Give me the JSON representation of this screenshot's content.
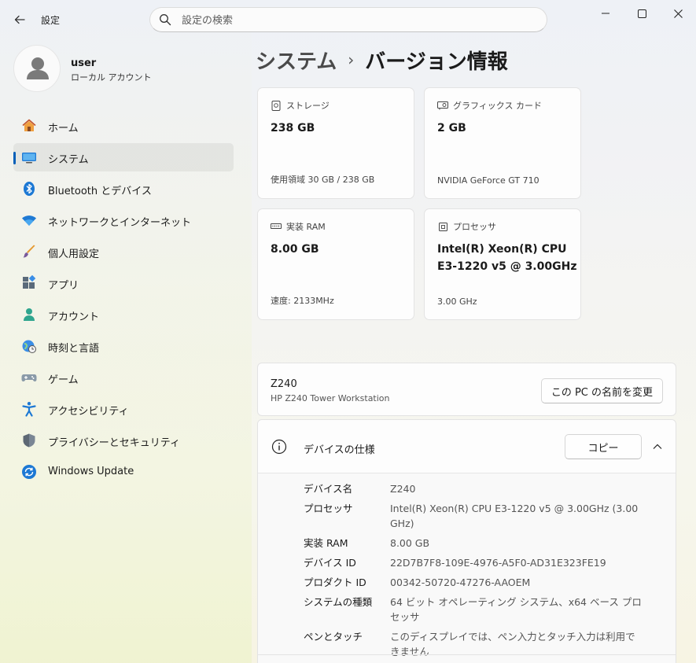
{
  "window": {
    "title": "設定"
  },
  "search": {
    "placeholder": "設定の検索"
  },
  "user": {
    "name": "user",
    "account_type": "ローカル アカウント"
  },
  "sidebar": {
    "items": [
      {
        "label": "ホーム",
        "icon": "home-icon"
      },
      {
        "label": "システム",
        "icon": "system-icon",
        "selected": true
      },
      {
        "label": "Bluetooth とデバイス",
        "icon": "bluetooth-icon"
      },
      {
        "label": "ネットワークとインターネット",
        "icon": "wifi-icon"
      },
      {
        "label": "個人用設定",
        "icon": "brush-icon"
      },
      {
        "label": "アプリ",
        "icon": "apps-icon"
      },
      {
        "label": "アカウント",
        "icon": "person-icon"
      },
      {
        "label": "時刻と言語",
        "icon": "globe-clock-icon"
      },
      {
        "label": "ゲーム",
        "icon": "gamepad-icon"
      },
      {
        "label": "アクセシビリティ",
        "icon": "accessibility-icon"
      },
      {
        "label": "プライバシーとセキュリティ",
        "icon": "shield-icon"
      },
      {
        "label": "Windows Update",
        "icon": "update-icon"
      }
    ]
  },
  "breadcrumb": {
    "parent": "システム",
    "separator": "›",
    "current": "バージョン情報"
  },
  "cards": {
    "storage": {
      "title": "ストレージ",
      "value": "238 GB",
      "sub": "使用領域 30 GB / 238 GB"
    },
    "gpu": {
      "title": "グラフィックス カード",
      "value": "2 GB",
      "sub": "NVIDIA GeForce GT 710"
    },
    "ram": {
      "title": "実装 RAM",
      "value": "8.00 GB",
      "sub": "速度: 2133MHz"
    },
    "cpu": {
      "title": "プロセッサ",
      "value_line1": "Intel(R) Xeon(R) CPU",
      "value_line2": "E3-1220 v5 @ 3.00GHz",
      "sub": "3.00 GHz"
    }
  },
  "device": {
    "name": "Z240",
    "model": "HP Z240 Tower Workstation",
    "rename_label": "この PC の名前を変更"
  },
  "specs": {
    "title": "デバイスの仕様",
    "copy_label": "コピー",
    "rows": [
      {
        "label": "デバイス名",
        "value": "Z240"
      },
      {
        "label": "プロセッサ",
        "value": "Intel(R) Xeon(R) CPU E3-1220 v5 @ 3.00GHz (3.00 GHz)"
      },
      {
        "label": "実装 RAM",
        "value": "8.00 GB"
      },
      {
        "label": "デバイス ID",
        "value": "22D7B7F8-109E-4976-A5F0-AD31E323FE19"
      },
      {
        "label": "プロダクト ID",
        "value": "00342-50720-47276-AAOEM"
      },
      {
        "label": "システムの種類",
        "value": "64 ビット オペレーティング システム、x64 ベース プロセッサ"
      },
      {
        "label": "ペンとタッチ",
        "value": "このディスプレイでは、ペン入力とタッチ入力は利用できません"
      }
    ]
  },
  "colors": {
    "accent": "#005fb8",
    "window_bg": "#f3f3f3"
  }
}
